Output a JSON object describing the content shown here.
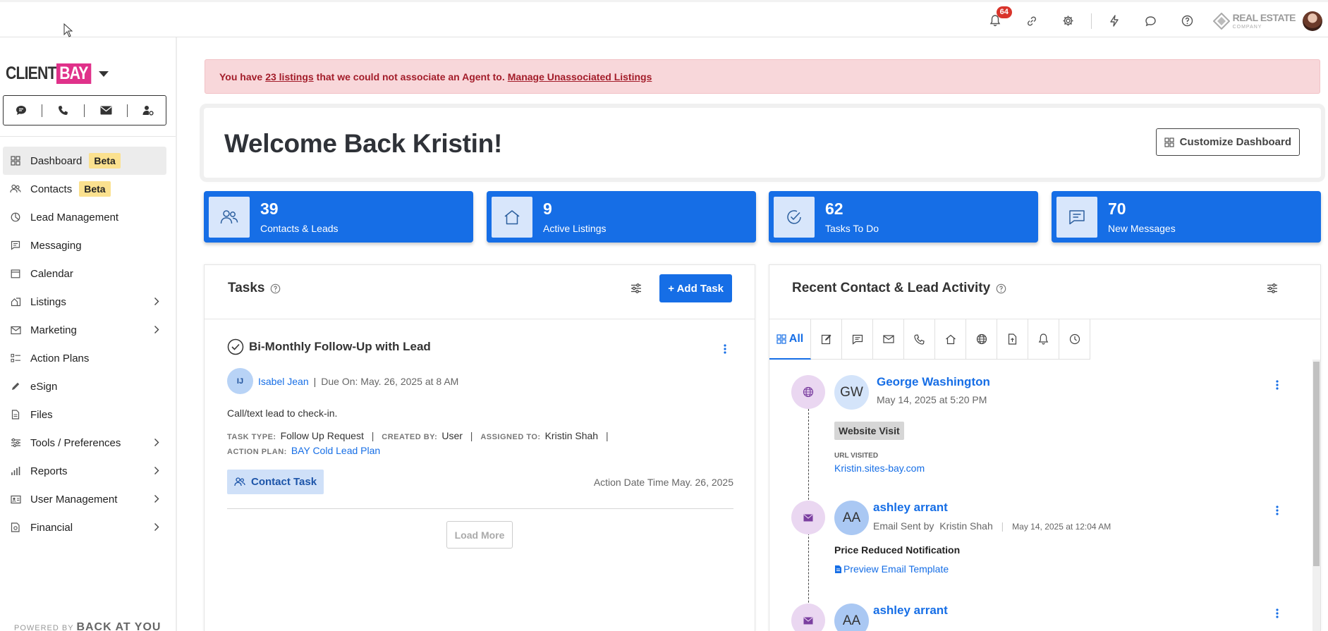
{
  "topbar": {
    "notifications_count": "64",
    "brand_name": "REAL ESTATE",
    "brand_sub": "COMPANY"
  },
  "sidebar": {
    "logo_client": "CLIENT",
    "logo_bay": "BAY",
    "items": [
      {
        "label": "Dashboard",
        "badge": "Beta"
      },
      {
        "label": "Contacts",
        "badge": "Beta"
      },
      {
        "label": "Lead Management"
      },
      {
        "label": "Messaging"
      },
      {
        "label": "Calendar"
      },
      {
        "label": "Listings"
      },
      {
        "label": "Marketing"
      },
      {
        "label": "Action Plans"
      },
      {
        "label": "eSign"
      },
      {
        "label": "Files"
      },
      {
        "label": "Tools / Preferences"
      },
      {
        "label": "Reports"
      },
      {
        "label": "User Management"
      },
      {
        "label": "Financial"
      }
    ],
    "powered_by": "POWERED BY",
    "powered_brand": "BACK AT YOU"
  },
  "alert": {
    "prefix": "You have",
    "count_link": "23 listings",
    "middle": "that we could not associate an Agent to.",
    "manage_link": "Manage Unassociated Listings"
  },
  "welcome": {
    "title": "Welcome Back Kristin!",
    "customize_label": "Customize Dashboard"
  },
  "stats": [
    {
      "value": "39",
      "label": "Contacts & Leads"
    },
    {
      "value": "9",
      "label": "Active Listings"
    },
    {
      "value": "62",
      "label": "Tasks To Do"
    },
    {
      "value": "70",
      "label": "New Messages"
    }
  ],
  "tasks": {
    "title": "Tasks",
    "add_label": "+ Add Task",
    "item": {
      "title": "Bi-Monthly Follow-Up with Lead",
      "initials": "IJ",
      "assignee": "Isabel Jean",
      "due": "Due On: May. 26, 2025 at 8 AM",
      "description": "Call/text lead to check-in.",
      "task_type_key": "TASK TYPE:",
      "task_type": "Follow Up Request",
      "created_by_key": "CREATED BY:",
      "created_by": "User",
      "assigned_to_key": "ASSIGNED TO:",
      "assigned_to": "Kristin Shah",
      "action_plan_key": "ACTION PLAN:",
      "action_plan": "BAY Cold Lead Plan",
      "contact_task_label": "Contact Task",
      "action_date": "Action Date Time May. 26, 2025"
    },
    "load_more": "Load More"
  },
  "activity": {
    "title": "Recent Contact & Lead Activity",
    "tab_all": "All",
    "items": [
      {
        "initials": "GW",
        "name": "George Washington",
        "time": "May 14, 2025 at 5:20 PM",
        "type": "Website Visit",
        "url_key": "URL VISITED",
        "url": "Kristin.sites-bay.com"
      },
      {
        "initials": "AA",
        "name": "ashley arrant",
        "sent_by_prefix": "Email Sent by",
        "sent_by": "Kristin Shah",
        "time": "May 14, 2025 at 12:04 AM",
        "subject": "Price Reduced Notification",
        "preview_label": "Preview Email Template"
      },
      {
        "initials": "AA",
        "name": "ashley arrant"
      }
    ]
  }
}
